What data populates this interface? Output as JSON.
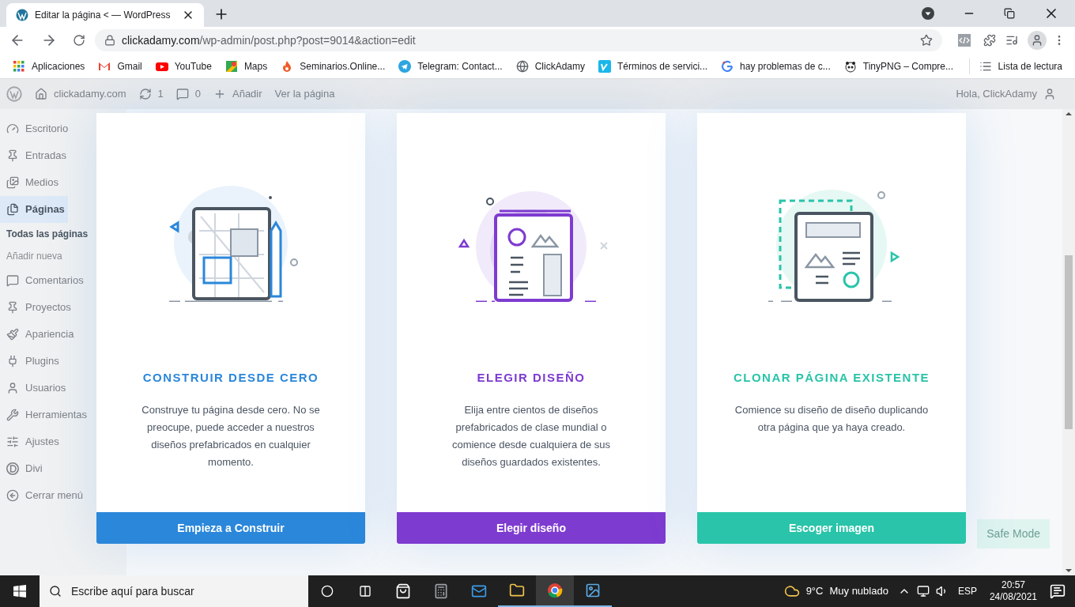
{
  "browser": {
    "tab_title": "Editar la página < — WordPress",
    "url_host": "clickadamy.com",
    "url_path": "/wp-admin/post.php?post=9014&action=edit",
    "bookmarks": [
      "Aplicaciones",
      "Gmail",
      "YouTube",
      "Maps",
      "Seminarios.Online...",
      "Telegram: Contact...",
      "ClickAdamy",
      "Términos de servici...",
      "hay problemas de c...",
      "TinyPNG – Compre..."
    ],
    "reading_list": "Lista de lectura"
  },
  "admin_bar": {
    "site": "clickadamy.com",
    "updates": "1",
    "comments": "0",
    "add": "Añadir",
    "view": "Ver la página",
    "greeting": "Hola, ClickAdamy"
  },
  "sidebar": {
    "items": [
      {
        "label": "Escritorio",
        "selected": false
      },
      {
        "label": "Entradas",
        "selected": false
      },
      {
        "label": "Medios",
        "selected": false
      },
      {
        "label": "Páginas",
        "selected": true,
        "children": [
          {
            "label": "Todas las páginas",
            "selected": true
          },
          {
            "label": "Añadir nueva",
            "selected": false
          }
        ]
      },
      {
        "label": "Comentarios",
        "selected": false
      },
      {
        "label": "Proyectos",
        "selected": false
      },
      {
        "label": "Apariencia",
        "selected": false
      },
      {
        "label": "Plugins",
        "selected": false
      },
      {
        "label": "Usuarios",
        "selected": false
      },
      {
        "label": "Herramientas",
        "selected": false
      },
      {
        "label": "Ajustes",
        "selected": false
      },
      {
        "label": "Divi",
        "selected": false
      },
      {
        "label": "Cerrar menú",
        "selected": false
      }
    ]
  },
  "background": {
    "safe_mode": "Safe Mode"
  },
  "cards": [
    {
      "kind": "build",
      "color": "#2b87da",
      "title": "CONSTRUIR DESDE CERO",
      "description": "Construye tu página desde cero. No se preocupe, puede acceder a nuestros diseños prefabricados en cualquier momento.",
      "button": "Empieza a Construir"
    },
    {
      "kind": "layout",
      "color": "#7e3bd0",
      "title": "ELEGIR DISEÑO",
      "description": "Elija entre cientos de diseños prefabricados de clase mundial o comience desde cualquiera de sus diseños guardados existentes.",
      "button": "Elegir diseño"
    },
    {
      "kind": "clone",
      "color": "#29c4a9",
      "title": "CLONAR PÁGINA EXISTENTE",
      "description": "Comience su diseño de diseño duplicando otra página que ya haya creado.",
      "button": "Escoger imagen"
    }
  ],
  "taskbar": {
    "search_placeholder": "Escribe aquí para buscar",
    "temperature": "9°C",
    "weather": "Muy nublado",
    "language": "ESP",
    "time": "20:57",
    "date": "24/08/2021"
  }
}
